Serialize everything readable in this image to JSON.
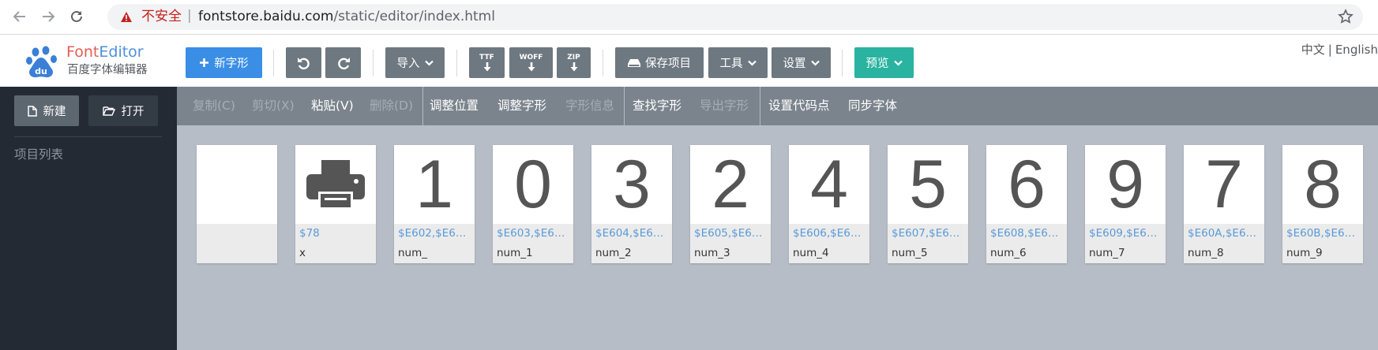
{
  "browser": {
    "insecure_label": "不安全",
    "separator": "|",
    "url_host": "fontstore.baidu.com",
    "url_path": "/static/editor/index.html"
  },
  "header": {
    "brand_font": "Font",
    "brand_editor": "Editor",
    "brand_subtitle": "百度字体编辑器",
    "new_glyph_label": "新字形",
    "import_label": "导入",
    "ttf_label": "TTF",
    "woff_label": "WOFF",
    "zip_label": "ZIP",
    "save_label": "保存项目",
    "tools_label": "工具",
    "settings_label": "设置",
    "preview_label": "预览",
    "lang_zh": "中文",
    "lang_sep": "|",
    "lang_en": "English"
  },
  "sidebar": {
    "new_label": "新建",
    "open_label": "打开",
    "project_list_title": "项目列表"
  },
  "toolbar": {
    "copy": "复制(C)",
    "cut": "剪切(X)",
    "paste": "粘贴(V)",
    "delete": "删除(D)",
    "adjust_pos": "调整位置",
    "adjust_glyph": "调整字形",
    "glyph_info": "字形信息",
    "find_glyph": "查找字形",
    "export_glyph": "导出字形",
    "set_codepoint": "设置代码点",
    "sync_font": "同步字体"
  },
  "glyphs": [
    {
      "char": "",
      "code": "",
      "name": ""
    },
    {
      "char": "",
      "code": "$78",
      "name": "x"
    },
    {
      "char": "1",
      "code": "$E602,$E60...",
      "name": "num_"
    },
    {
      "char": "0",
      "code": "$E603,$E60...",
      "name": "num_1"
    },
    {
      "char": "3",
      "code": "$E604,$E61...",
      "name": "num_2"
    },
    {
      "char": "2",
      "code": "$E605,$E61...",
      "name": "num_3"
    },
    {
      "char": "4",
      "code": "$E606,$E60...",
      "name": "num_4"
    },
    {
      "char": "5",
      "code": "$E607,$E60...",
      "name": "num_5"
    },
    {
      "char": "6",
      "code": "$E608,$E61...",
      "name": "num_6"
    },
    {
      "char": "9",
      "code": "$E609,$E61...",
      "name": "num_7"
    },
    {
      "char": "7",
      "code": "$E60A,$E61...",
      "name": "num_8"
    },
    {
      "char": "8",
      "code": "$E60B,$E61...",
      "name": "num_9"
    }
  ],
  "colors": {
    "primary_blue": "#3a8ee6",
    "button_gray": "#6e7880",
    "preview_teal": "#29b3a0",
    "sidebar_bg": "#232a33",
    "toolbar_bg": "#7b848d",
    "glyph_area_bg": "#b6bdc6",
    "code_blue": "#5a9ad6"
  },
  "icons": [
    "back-arrow-icon",
    "forward-arrow-icon",
    "reload-icon",
    "warning-icon",
    "star-icon",
    "baidu-paw-logo",
    "plus-icon",
    "undo-icon",
    "redo-icon",
    "chevron-down-icon",
    "download-arrow-icon",
    "hard-drive-icon",
    "file-icon",
    "folder-open-icon",
    "printer-icon"
  ]
}
